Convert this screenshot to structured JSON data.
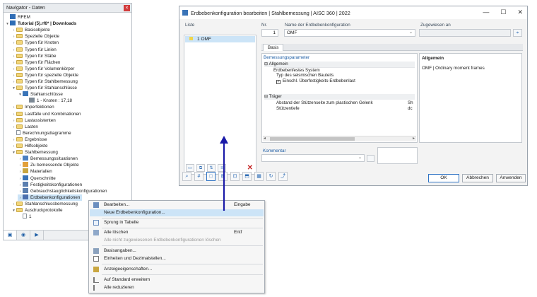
{
  "navigator": {
    "title": "Navigator - Daten",
    "tree": [
      {
        "label": "RFEM",
        "indent": 0,
        "arrow": "",
        "icon": "rfem",
        "bold": false
      },
      {
        "label": "Tutorial (5).rf6* | Downloads",
        "indent": 0,
        "arrow": "▾",
        "icon": "model",
        "bold": true
      },
      {
        "label": "Basisobjekte",
        "indent": 1,
        "arrow": "›",
        "icon": "folder"
      },
      {
        "label": "Spezielle Objekte",
        "indent": 1,
        "arrow": "›",
        "icon": "folder"
      },
      {
        "label": "Typen für Knoten",
        "indent": 1,
        "arrow": "›",
        "icon": "folder"
      },
      {
        "label": "Typen für Linien",
        "indent": 1,
        "arrow": "›",
        "icon": "folder"
      },
      {
        "label": "Typen für Stäbe",
        "indent": 1,
        "arrow": "›",
        "icon": "folder"
      },
      {
        "label": "Typen für Flächen",
        "indent": 1,
        "arrow": "›",
        "icon": "folder"
      },
      {
        "label": "Typen für Volumenkörper",
        "indent": 1,
        "arrow": "›",
        "icon": "folder"
      },
      {
        "label": "Typen für spezielle Objekte",
        "indent": 1,
        "arrow": "›",
        "icon": "folder"
      },
      {
        "label": "Typen für Stahlbemessung",
        "indent": 1,
        "arrow": "›",
        "icon": "folder"
      },
      {
        "label": "Typen für Stahlanschlüsse",
        "indent": 1,
        "arrow": "▾",
        "icon": "folder"
      },
      {
        "label": "Stahlanschlüsse",
        "indent": 2,
        "arrow": "▾",
        "icon": "connection"
      },
      {
        "label": "1 - Knoten : 17,18",
        "indent": 3,
        "arrow": "",
        "icon": "item"
      },
      {
        "label": "Imperfektionen",
        "indent": 1,
        "arrow": "›",
        "icon": "folder"
      },
      {
        "label": "Lastfälle und Kombinationen",
        "indent": 1,
        "arrow": "›",
        "icon": "folder"
      },
      {
        "label": "Lastassistenten",
        "indent": 1,
        "arrow": "›",
        "icon": "folder"
      },
      {
        "label": "Lasten",
        "indent": 1,
        "arrow": "›",
        "icon": "folder"
      },
      {
        "label": "Berechnungsdiagramme",
        "indent": 1,
        "arrow": "",
        "icon": "doc"
      },
      {
        "label": "Ergebnisse",
        "indent": 1,
        "arrow": "›",
        "icon": "folder"
      },
      {
        "label": "Hilfsobjekte",
        "indent": 1,
        "arrow": "›",
        "icon": "folder"
      },
      {
        "label": "Stahlbemessung",
        "indent": 1,
        "arrow": "▾",
        "icon": "folder"
      },
      {
        "label": "Bemessungssituationen",
        "indent": 2,
        "arrow": "›",
        "icon": "design"
      },
      {
        "label": "Zu bemessende Objekte",
        "indent": 2,
        "arrow": "›",
        "icon": "objects"
      },
      {
        "label": "Materialien",
        "indent": 2,
        "arrow": "›",
        "icon": "material"
      },
      {
        "label": "Querschnitte",
        "indent": 2,
        "arrow": "›",
        "icon": "section"
      },
      {
        "label": "Festigkeitskonfigurationen",
        "indent": 2,
        "arrow": "›",
        "icon": "config"
      },
      {
        "label": "Gebrauchstauglichkeitskonfigurationen",
        "indent": 2,
        "arrow": "›",
        "icon": "config"
      },
      {
        "label": "Erdbebenkonfigurationen",
        "indent": 2,
        "arrow": "›",
        "icon": "seismic",
        "selected": true
      },
      {
        "label": "Stahlanschlussbemessung",
        "indent": 1,
        "arrow": "›",
        "icon": "folder"
      },
      {
        "label": "Ausdruckprotokolle",
        "indent": 1,
        "arrow": "▾",
        "icon": "folder"
      },
      {
        "label": "1",
        "indent": 2,
        "arrow": "",
        "icon": "doc"
      }
    ],
    "tabs": [
      "▣",
      "◉",
      "▶"
    ]
  },
  "dialog": {
    "title": "Erdbebenkonfiguration bearbeiten | Stahlbemessung | AISC 360 | 2022",
    "window_buttons": [
      "—",
      "☐",
      "✕"
    ],
    "list_label": "Liste",
    "list_items": [
      {
        "no": "1",
        "name": "OMF"
      }
    ],
    "nr_label": "Nr.",
    "nr_value": "1",
    "name_label": "Name der Erdbebenkonfiguration",
    "name_value": "OMF",
    "assigned_label": "Zugewiesen an",
    "assigned_value": "",
    "tab_basis": "Basis",
    "params_header": "Bemessungsparameter",
    "params": {
      "allgemein": "Allgemein",
      "erdbebenfestes_system": "Erdbebenfestes System",
      "typ": "Typ des seismischen Bauteils",
      "einschl": "Einschl. Überfestigkeits-Erdbebenlast",
      "traeger": "Träger",
      "abstand": "Abstand der Stützenseite zum plastischen Gelenk",
      "abstand_val": "Sh",
      "stuetzentiefe": "Stützentiefe",
      "stuetzentiefe_val": "dc"
    },
    "info_header": "Allgemein",
    "info_text": "OMF | Ordinary moment frames",
    "comment_label": "Kommentar",
    "buttons": {
      "ok": "OK",
      "cancel": "Abbrechen",
      "apply": "Anwenden"
    }
  },
  "context_menu": {
    "items": [
      {
        "label": "Bearbeiten...",
        "shortcut": "Eingabe",
        "icon": "edit",
        "state": "normal"
      },
      {
        "label": "Neue Erdbebenkonfiguration...",
        "shortcut": "",
        "icon": "",
        "state": "highlight"
      },
      {
        "label": "Sprung in Tabelle",
        "shortcut": "",
        "icon": "table",
        "state": "normal"
      },
      {
        "label": "Alle löschen",
        "shortcut": "Entf",
        "icon": "delete",
        "state": "normal"
      },
      {
        "label": "Alle nicht zugewiesenen Erdbebenkonfigurationen löschen",
        "shortcut": "",
        "icon": "",
        "state": "disabled"
      },
      {
        "label": "Basisangaben...",
        "shortcut": "",
        "icon": "basic",
        "state": "normal"
      },
      {
        "label": "Einheiten und Dezimalstellen...",
        "shortcut": "",
        "icon": "units",
        "state": "normal"
      },
      {
        "label": "Anzeigeeigenschaften...",
        "shortcut": "",
        "icon": "display",
        "state": "normal"
      },
      {
        "label": "Auf Standard erweitern",
        "shortcut": "",
        "icon": "expand",
        "state": "normal"
      },
      {
        "label": "Alle reduzieren",
        "shortcut": "",
        "icon": "collapse",
        "state": "normal"
      }
    ]
  },
  "colors": {
    "selection": "#cce4f7",
    "accent": "#1f5fa6",
    "arrow": "#1a1aa8",
    "close_red": "#d23c3c"
  }
}
